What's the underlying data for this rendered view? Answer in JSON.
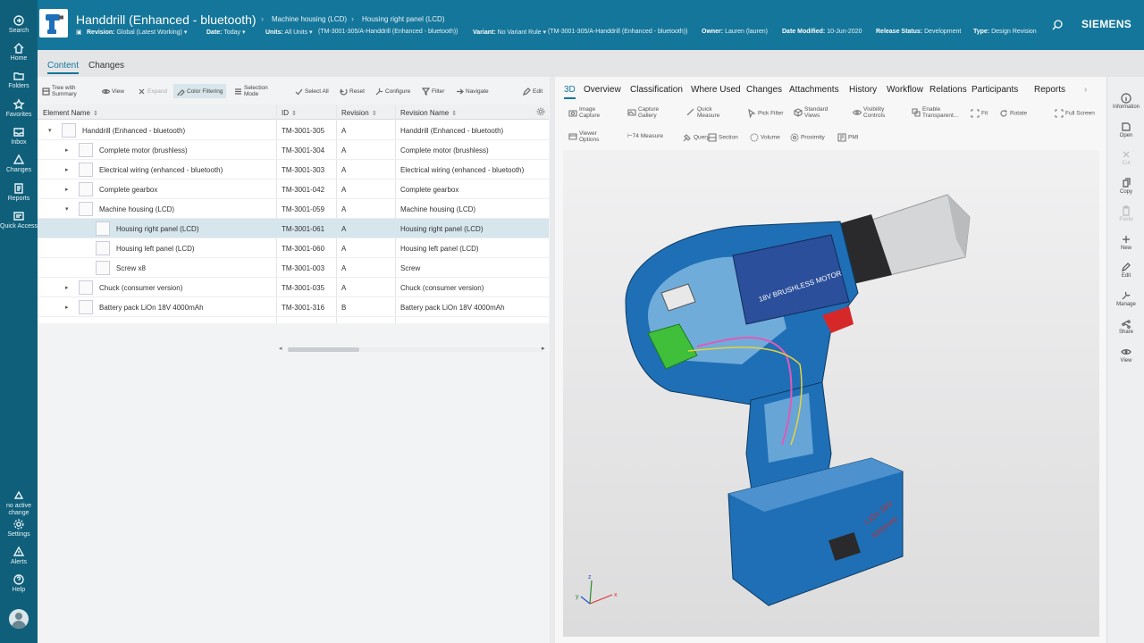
{
  "colors": {
    "nav": "#0f5f7a",
    "header": "#14769a",
    "accent": "#14769a",
    "selected_row": "#d6e6ec"
  },
  "leftnav": {
    "items": [
      {
        "label": "Search",
        "icon": "search-icon"
      },
      {
        "label": "Home",
        "icon": "home-icon"
      },
      {
        "label": "Folders",
        "icon": "folder-icon"
      },
      {
        "label": "Favorites",
        "icon": "star-icon"
      },
      {
        "label": "Inbox",
        "icon": "inbox-icon"
      },
      {
        "label": "Changes",
        "icon": "changes-icon"
      },
      {
        "label": "Reports",
        "icon": "report-icon"
      },
      {
        "label": "Quick Access",
        "icon": "quick-access-icon"
      }
    ],
    "change_status": "no active change",
    "settings": "Settings",
    "alerts": "Alerts",
    "help": "Help"
  },
  "header": {
    "title": "Handdrill (Enhanced - bluetooth)",
    "breadcrumb": [
      "Machine housing (LCD)",
      "Housing right panel (LCD)"
    ],
    "brand": "SIEMENS",
    "props": {
      "revision_label": "Revision:",
      "revision_value": "Global (Latest Working) ▾",
      "date_label": "Date:",
      "date_value": "Today ▾",
      "units_label": "Units:",
      "units_value": "All Units ▾",
      "units_extra": "(TM-3001-305/A-Handdrill (Enhanced - bluetooth))",
      "variant_label": "Variant:",
      "variant_value": "No Variant Rule ▾",
      "variant_extra": "(TM-3001-305/A-Handdrill (Enhanced - bluetooth))",
      "owner_label": "Owner:",
      "owner_value": "Lauren (lauren)",
      "modified_label": "Date Modified:",
      "modified_value": "10-Jun-2020",
      "status_label": "Release Status:",
      "status_value": "Development",
      "type_label": "Type:",
      "type_value": "Design Revision"
    }
  },
  "subtabs": {
    "content": "Content",
    "changes": "Changes"
  },
  "toolbar": {
    "tree_summary": [
      "Tree with",
      "Summary"
    ],
    "view": "View",
    "expand": "Expand",
    "color_filtering": "Color Filtering",
    "selection_mode": [
      "Selection",
      "Mode"
    ],
    "select_all": "Select All",
    "reset": "Reset",
    "configure": "Configure",
    "filter": "Filter",
    "navigate": "Navigate",
    "edit": "Edit"
  },
  "grid": {
    "columns": [
      "Element Name",
      "ID",
      "Revision",
      "Revision Name"
    ],
    "rows": [
      {
        "name": "Handdrill (Enhanced - bluetooth)",
        "id": "TM-3001-305",
        "rev": "A",
        "revname": "Handdrill (Enhanced - bluetooth)",
        "level": 0,
        "twisty": "▾"
      },
      {
        "name": "Complete motor (brushless)",
        "id": "TM-3001-304",
        "rev": "A",
        "revname": "Complete motor (brushless)",
        "level": 1,
        "twisty": "▸"
      },
      {
        "name": "Electrical wiring (enhanced - bluetooth)",
        "id": "TM-3001-303",
        "rev": "A",
        "revname": "Electrical wiring (enhanced - bluetooth)",
        "level": 1,
        "twisty": "▸"
      },
      {
        "name": "Complete gearbox",
        "id": "TM-3001-042",
        "rev": "A",
        "revname": "Complete gearbox",
        "level": 1,
        "twisty": "▸"
      },
      {
        "name": "Machine housing (LCD)",
        "id": "TM-3001-059",
        "rev": "A",
        "revname": "Machine housing (LCD)",
        "level": 1,
        "twisty": "▾"
      },
      {
        "name": "Housing right panel (LCD)",
        "id": "TM-3001-061",
        "rev": "A",
        "revname": "Housing right panel (LCD)",
        "level": 2,
        "twisty": ""
      },
      {
        "name": "Housing left panel (LCD)",
        "id": "TM-3001-060",
        "rev": "A",
        "revname": "Housing left panel (LCD)",
        "level": 2,
        "twisty": ""
      },
      {
        "name": "Screw x8",
        "id": "TM-3001-003",
        "rev": "A",
        "revname": "Screw",
        "level": 2,
        "twisty": ""
      },
      {
        "name": "Chuck (consumer version)",
        "id": "TM-3001-035",
        "rev": "A",
        "revname": "Chuck (consumer version)",
        "level": 1,
        "twisty": "▸"
      },
      {
        "name": "Battery pack LiOn 18V 4000mAh",
        "id": "TM-3001-316",
        "rev": "B",
        "revname": "Battery pack LiOn 18V 4000mAh",
        "level": 1,
        "twisty": "▸"
      }
    ]
  },
  "viewtabs": [
    "3D",
    "Overview",
    "Classification",
    "Where Used",
    "Changes",
    "Attachments",
    "History",
    "Workflow",
    "Relations",
    "Participants",
    "Reports"
  ],
  "viewtools": {
    "image_capture": [
      "Image",
      "Capture"
    ],
    "capture_gallery": [
      "Capture",
      "Gallery"
    ],
    "quick_measure": [
      "Quick",
      "Measure"
    ],
    "pick_filter": "Pick Filter",
    "standard_views": [
      "Standard",
      "Views"
    ],
    "visibility_controls": [
      "Visibility",
      "Controls"
    ],
    "enable_transparent": [
      "Enable",
      "Transparent..."
    ],
    "fit": "Fit",
    "rotate": "Rotate",
    "full_screen": "Full Screen",
    "viewer_options": [
      "Viewer",
      "Options"
    ],
    "measure": "Measure",
    "query": "Query",
    "section": "Section",
    "volume": "Volume",
    "proximity": "Proximity",
    "pmi": "PMI"
  },
  "model": {
    "motor_label": "18V BRUSHLESS MOTOR",
    "battery_label_1": "LiOn 18V",
    "battery_label_2": "5000mAh"
  },
  "rightrail": [
    "Information",
    "Open",
    "Cut",
    "Copy",
    "Paste",
    "New",
    "Edit",
    "Manage",
    "Share",
    "View"
  ]
}
